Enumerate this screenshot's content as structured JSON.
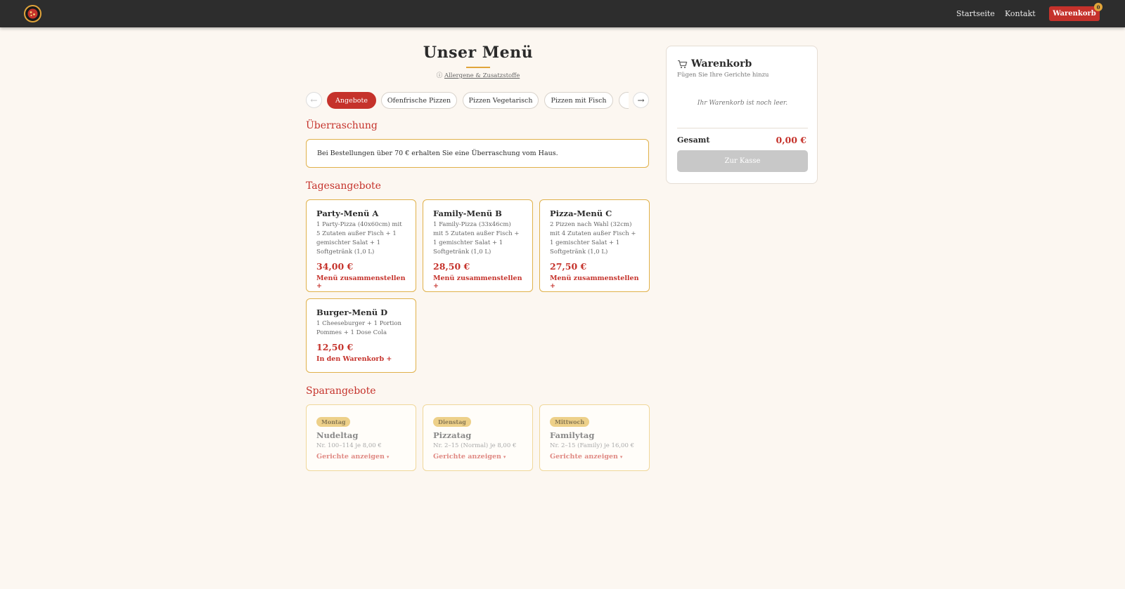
{
  "nav": {
    "home_label": "Startseite",
    "contact_label": "Kontakt",
    "cart_label": "Warenkorb",
    "cart_count": "0"
  },
  "header": {
    "title": "Unser Menü",
    "allergens_icon": "info-icon",
    "allergens_label": "Allergene & Zusatzstoffe"
  },
  "categories": [
    {
      "label": "Angebote",
      "active": true
    },
    {
      "label": "Ofenfrische Pizzen",
      "active": false
    },
    {
      "label": "Pizzen Vegetarisch",
      "active": false
    },
    {
      "label": "Pizzen mit Fisch",
      "active": false
    }
  ],
  "surprise": {
    "heading": "Überraschung",
    "text": "Bei Bestellungen über 70 € erhalten Sie eine Überraschung vom Haus."
  },
  "daily_offers": {
    "heading": "Tagesangebote",
    "items": [
      {
        "title": "Party-Menü A",
        "description": "1 Party-Pizza (40x60cm) mit 5 Zutaten außer Fisch + 1 gemischter Salat + 1 Softgetränk (1,0 L)",
        "price": "34,00 €",
        "action": "Menü zusammenstellen +"
      },
      {
        "title": "Family-Menü B",
        "description": "1 Family-Pizza (33x46cm) mit 5 Zutaten außer Fisch + 1 gemischter Salat + 1 Softgetränk (1,0 L)",
        "price": "28,50 €",
        "action": "Menü zusammenstellen +"
      },
      {
        "title": "Pizza-Menü C",
        "description": "2 Pizzen nach Wahl (32cm) mit 4 Zutaten außer Fisch + 1 gemischter Salat + 1 Softgetränk (1,0 L)",
        "price": "27,50 €",
        "action": "Menü zusammenstellen +"
      },
      {
        "title": "Burger-Menü D",
        "description": "1 Cheeseburger + 1 Portion Pommes + 1 Dose Cola",
        "price": "12,50 €",
        "action": "In den Warenkorb +"
      }
    ]
  },
  "savings": {
    "heading": "Sparangebote",
    "items": [
      {
        "day": "Montag",
        "title": "Nudeltag",
        "description": "Nr. 100–114 je 8,00 €",
        "action": "Gerichte anzeigen",
        "caret": "▾"
      },
      {
        "day": "Dienstag",
        "title": "Pizzatag",
        "description": "Nr. 2–15 (Normal) je 8,00 €",
        "action": "Gerichte anzeigen",
        "caret": "▾"
      },
      {
        "day": "Mittwoch",
        "title": "Familytag",
        "description": "Nr. 2–15 (Family) je 16,00 €",
        "action": "Gerichte anzeigen",
        "caret": "▾"
      }
    ]
  },
  "cart_panel": {
    "title": "Warenkorb",
    "subtitle": "Fügen Sie Ihre Gerichte hinzu",
    "empty_text": "Ihr Warenkorb ist noch leer.",
    "total_label": "Gesamt",
    "total_value": "0,00 €",
    "checkout_label": "Zur Kasse"
  },
  "colors": {
    "accent": "#c5322b",
    "gold": "#e0a43a",
    "topbar": "#2d2d2d",
    "background": "#fcf7f1"
  }
}
